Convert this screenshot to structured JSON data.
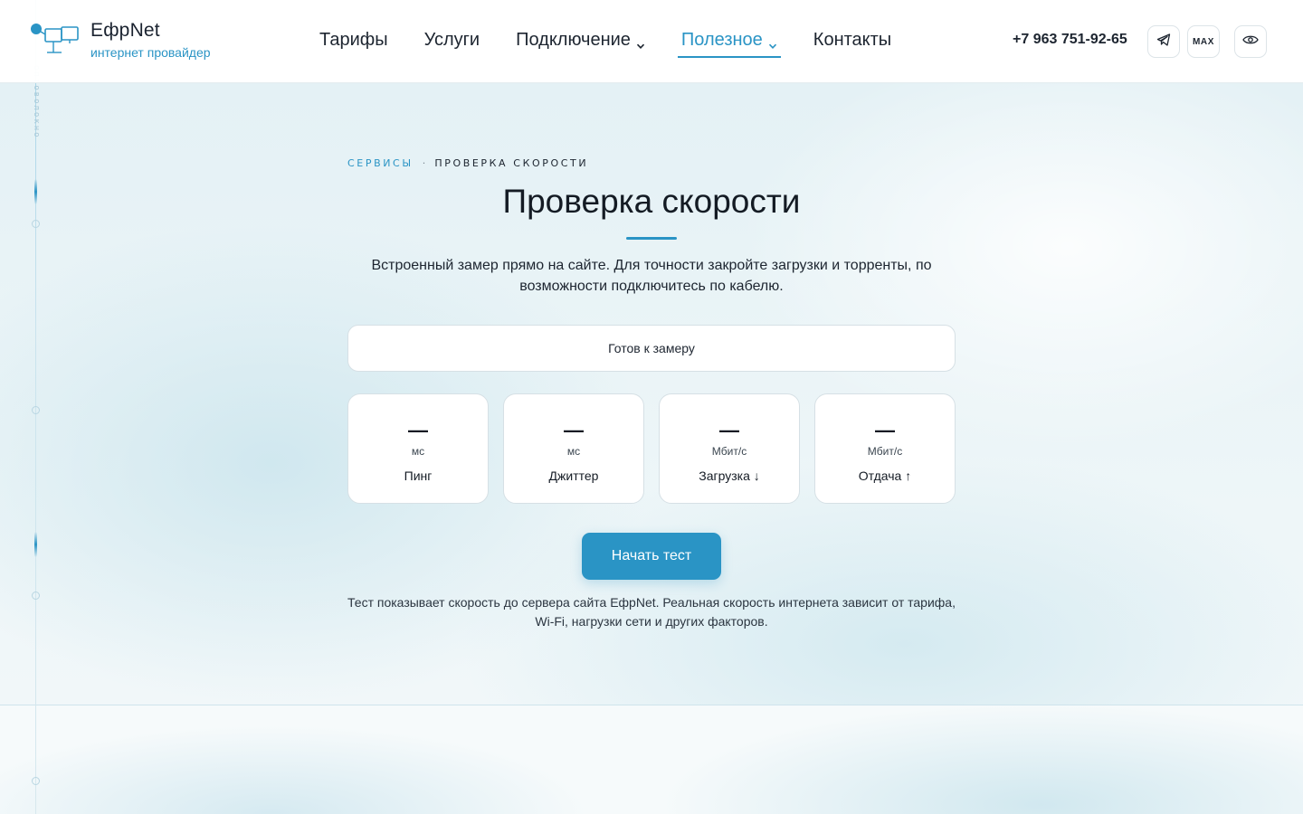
{
  "header": {
    "brand": "ЕфрNet",
    "tagline": "интернет провайдер",
    "nav": [
      {
        "label": "Тарифы"
      },
      {
        "label": "Услуги"
      },
      {
        "label": "Подключение"
      },
      {
        "label": "Полезное"
      },
      {
        "label": "Контакты"
      }
    ],
    "phone": "+7 963 751-92-65",
    "max_label": "MAX",
    "accent_color": "#2a94c5"
  },
  "side_decoration": {
    "vertical_text": "оптоволокно"
  },
  "main": {
    "breadcrumb": {
      "link": "СЕРВИСЫ",
      "separator": "·",
      "current": "ПРОВЕРКА СКОРОСТИ"
    },
    "title": "Проверка скорости",
    "lead": "Встроенный замер прямо на сайте. Для точности закройте загрузки и торренты, по возможности подключитесь по кабелю.",
    "status": "Готов к замеру",
    "metrics": [
      {
        "value": "—",
        "unit": "мс",
        "label": "Пинг"
      },
      {
        "value": "—",
        "unit": "мс",
        "label": "Джиттер"
      },
      {
        "value": "—",
        "unit": "Мбит/с",
        "label": "Загрузка ↓"
      },
      {
        "value": "—",
        "unit": "Мбит/с",
        "label": "Отдача ↑"
      }
    ],
    "start_button": "Начать тест",
    "note": "Тест показывает скорость до сервера сайта ЕфрNet. Реальная скорость интернета зависит от тарифа, Wi-Fi, нагрузки сети и других факторов."
  }
}
